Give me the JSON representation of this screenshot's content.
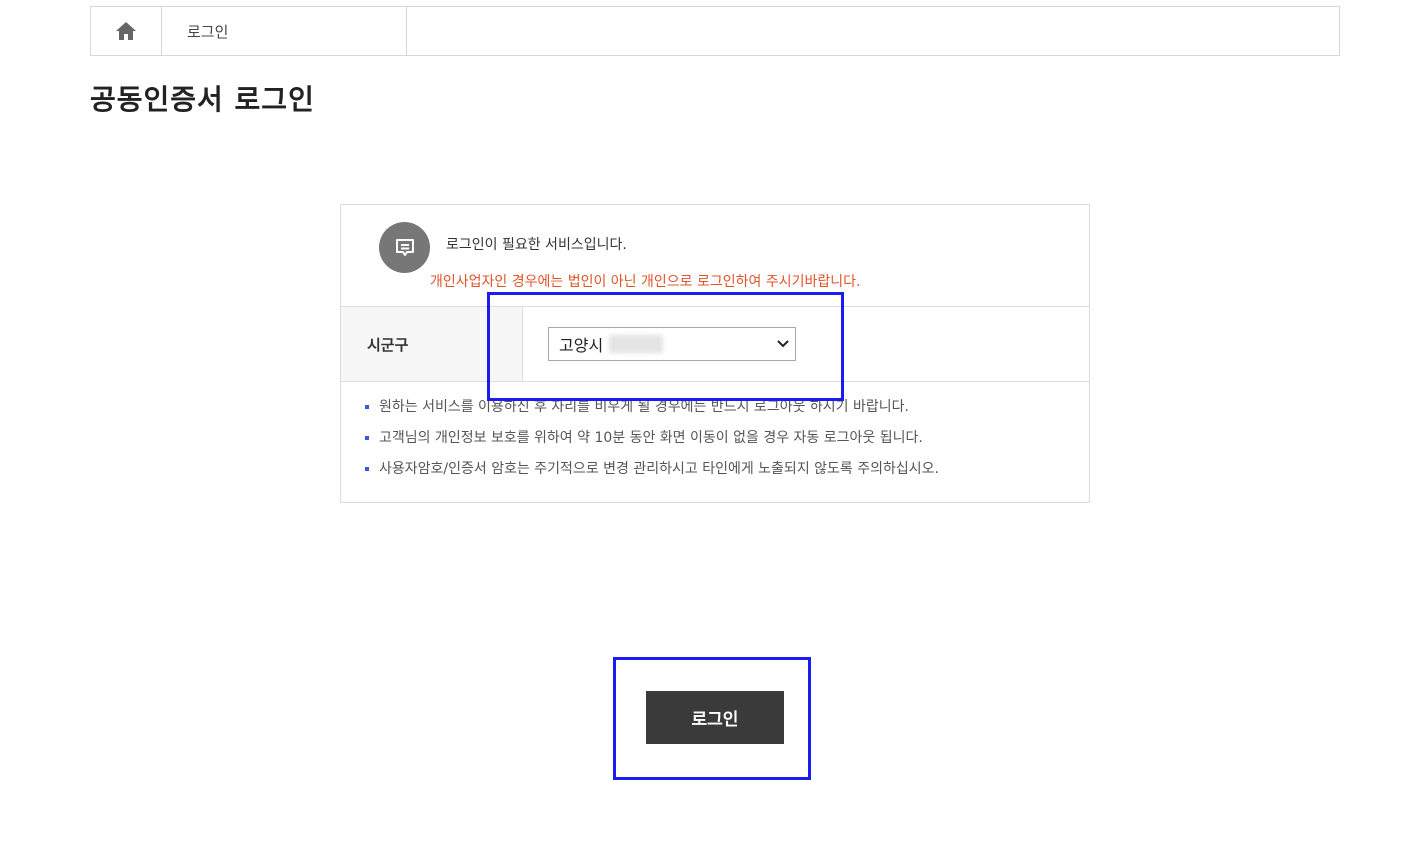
{
  "breadcrumb": {
    "home_icon": "home-icon",
    "current": "로그인"
  },
  "page": {
    "title": "공동인증서 로그인"
  },
  "notice": {
    "icon": "message-icon",
    "main": "로그인이 필요한 서비스입니다.",
    "warning": "개인사업자인 경우에는 법인이 아닌 개인으로 로그인하여 주시기바랍니다.",
    "warning_color": "#e0542b"
  },
  "region": {
    "label": "시군구",
    "selected_value": "고양시"
  },
  "tips": [
    "원하는 서비스를 이용하신 후 자리를 비우게 될 경우에는 반드시 로그아웃 하시기 바랍니다.",
    "고객님의 개인정보 보호를 위하여 약 10분 동안 화면 이동이 없을 경우 자동 로그아웃 됩니다.",
    "사용자암호/인증서 암호는 주기적으로 변경 관리하시고 타인에게 노출되지 않도록 주의하십시오."
  ],
  "actions": {
    "login_label": "로그인"
  },
  "colors": {
    "highlight": "#1c1cf0",
    "button_bg": "#3a3a3a",
    "bullet": "#3a5ad9"
  }
}
